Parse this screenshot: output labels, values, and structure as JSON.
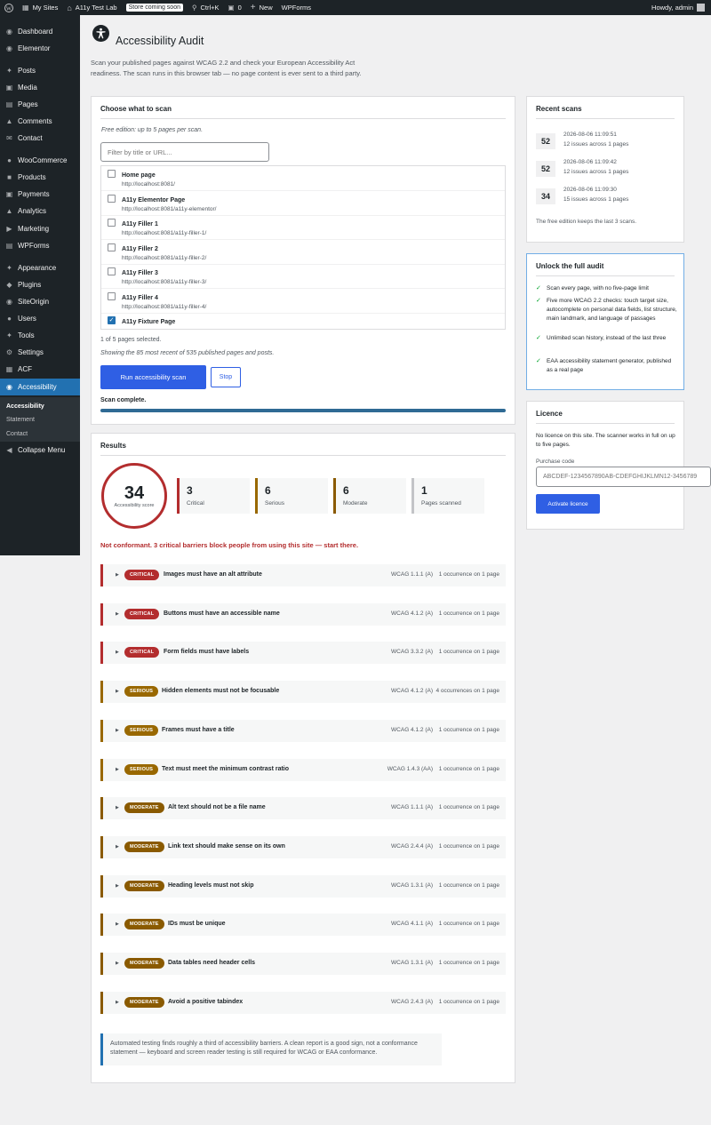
{
  "admin_bar": {
    "my_sites": "My Sites",
    "site_name": "A11y Test Lab",
    "store_badge": "Store coming soon",
    "search_shortcut": "Ctrl+K",
    "comments_count": "0",
    "new_label": "New",
    "wpforms": "WPForms",
    "howdy": "Howdy, admin"
  },
  "sidebar": {
    "items": [
      {
        "label": "Dashboard",
        "icon": "dashboard-icon"
      },
      {
        "label": "Elementor",
        "icon": "elementor-icon"
      },
      {
        "label": "Posts",
        "icon": "pin-icon"
      },
      {
        "label": "Media",
        "icon": "media-icon"
      },
      {
        "label": "Pages",
        "icon": "pages-icon"
      },
      {
        "label": "Comments",
        "icon": "comments-icon"
      },
      {
        "label": "Contact",
        "icon": "mail-icon"
      },
      {
        "label": "WooCommerce",
        "icon": "woo-icon"
      },
      {
        "label": "Products",
        "icon": "products-icon"
      },
      {
        "label": "Payments",
        "icon": "payments-icon"
      },
      {
        "label": "Analytics",
        "icon": "analytics-icon"
      },
      {
        "label": "Marketing",
        "icon": "megaphone-icon"
      },
      {
        "label": "WPForms",
        "icon": "forms-icon"
      },
      {
        "label": "Appearance",
        "icon": "brush-icon"
      },
      {
        "label": "Plugins",
        "icon": "plugin-icon"
      },
      {
        "label": "SiteOrigin",
        "icon": "siteorigin-icon"
      },
      {
        "label": "Users",
        "icon": "users-icon"
      },
      {
        "label": "Tools",
        "icon": "wrench-icon"
      },
      {
        "label": "Settings",
        "icon": "settings-icon"
      },
      {
        "label": "ACF",
        "icon": "acf-icon"
      },
      {
        "label": "Accessibility",
        "icon": "accessibility-icon"
      }
    ],
    "submenu": [
      "Accessibility",
      "Statement",
      "Contact"
    ],
    "collapse": "Collapse Menu"
  },
  "header": {
    "title": "Accessibility Audit",
    "intro": "Scan your published pages against WCAG 2.2 and check your European Accessibility Act readiness. The scan runs in this browser tab — no page content is ever sent to a third party."
  },
  "scan": {
    "title": "Choose what to scan",
    "edition_note": "Free edition: up to 5 pages per scan.",
    "filter_placeholder": "Filter by title or URL...",
    "pages": [
      {
        "name": "Home page",
        "url": "http://localhost:8081/",
        "checked": false
      },
      {
        "name": "A11y Elementor Page",
        "url": "http://localhost:8081/a11y-elementor/",
        "checked": false
      },
      {
        "name": "A11y Filler 1",
        "url": "http://localhost:8081/a11y-filler-1/",
        "checked": false
      },
      {
        "name": "A11y Filler 2",
        "url": "http://localhost:8081/a11y-filler-2/",
        "checked": false
      },
      {
        "name": "A11y Filler 3",
        "url": "http://localhost:8081/a11y-filler-3/",
        "checked": false
      },
      {
        "name": "A11y Filler 4",
        "url": "http://localhost:8081/a11y-filler-4/",
        "checked": false
      },
      {
        "name": "A11y Fixture Page",
        "url": "",
        "checked": true
      }
    ],
    "selected_count": "1 of 5 pages selected.",
    "showing_note": "Showing the 85 most recent of 535 published pages and posts.",
    "run_button": "Run accessibility scan",
    "stop_button": "Stop",
    "status": "Scan complete.",
    "progress": 1.0
  },
  "results": {
    "title": "Results",
    "score": "34",
    "score_label": "Accessibility score",
    "stats": [
      {
        "num": "3",
        "label": "Critical",
        "color": "#b32d2e"
      },
      {
        "num": "6",
        "label": "Serious",
        "color": "#996800"
      },
      {
        "num": "6",
        "label": "Moderate",
        "color": "#8a5a00"
      },
      {
        "num": "1",
        "label": "Pages scanned",
        "color": "#c3c4c7"
      }
    ],
    "verdict": "Not conformant. 3 critical barriers block people from using this site — start there.",
    "issues": [
      {
        "severity": "CRITICAL",
        "title": "Images must have an alt attribute",
        "wcag": "WCAG 1.1.1 (A)",
        "occ": "1 occurrence on 1 page"
      },
      {
        "severity": "CRITICAL",
        "title": "Buttons must have an accessible name",
        "wcag": "WCAG 4.1.2 (A)",
        "occ": "1 occurrence on 1 page"
      },
      {
        "severity": "CRITICAL",
        "title": "Form fields must have labels",
        "wcag": "WCAG 3.3.2 (A)",
        "occ": "1 occurrence on 1 page"
      },
      {
        "severity": "SERIOUS",
        "title": "Hidden elements must not be focusable",
        "wcag": "WCAG 4.1.2 (A)",
        "occ": "4 occurrences on 1 page"
      },
      {
        "severity": "SERIOUS",
        "title": "Frames must have a title",
        "wcag": "WCAG 4.1.2 (A)",
        "occ": "1 occurrence on 1 page"
      },
      {
        "severity": "SERIOUS",
        "title": "Text must meet the minimum contrast ratio",
        "wcag": "WCAG 1.4.3 (AA)",
        "occ": "1 occurrence on 1 page"
      },
      {
        "severity": "MODERATE",
        "title": "Alt text should not be a file name",
        "wcag": "WCAG 1.1.1 (A)",
        "occ": "1 occurrence on 1 page"
      },
      {
        "severity": "MODERATE",
        "title": "Link text should make sense on its own",
        "wcag": "WCAG 2.4.4 (A)",
        "occ": "1 occurrence on 1 page"
      },
      {
        "severity": "MODERATE",
        "title": "Heading levels must not skip",
        "wcag": "WCAG 1.3.1 (A)",
        "occ": "1 occurrence on 1 page"
      },
      {
        "severity": "MODERATE",
        "title": "IDs must be unique",
        "wcag": "WCAG 4.1.1 (A)",
        "occ": "1 occurrence on 1 page"
      },
      {
        "severity": "MODERATE",
        "title": "Data tables need header cells",
        "wcag": "WCAG 1.3.1 (A)",
        "occ": "1 occurrence on 1 page"
      },
      {
        "severity": "MODERATE",
        "title": "Avoid a positive tabindex",
        "wcag": "WCAG 2.4.3 (A)",
        "occ": "1 occurrence on 1 page"
      }
    ],
    "severity_colors": {
      "CRITICAL": "#b32d2e",
      "SERIOUS": "#996800",
      "MODERATE": "#8a5a00"
    },
    "note": "Automated testing finds roughly a third of accessibility barriers. A clean report is a good sign, not a conformance statement — keyboard and screen reader testing is still required for WCAG or EAA conformance."
  },
  "recent": {
    "title": "Recent scans",
    "scans": [
      {
        "score": "52",
        "date": "2026-08-06 11:09:51",
        "issues": "12 issues across 1 pages"
      },
      {
        "score": "52",
        "date": "2026-08-06 11:09:42",
        "issues": "12 issues across 1 pages"
      },
      {
        "score": "34",
        "date": "2026-08-06 11:09:30",
        "issues": "15 issues across 1 pages"
      }
    ],
    "note": "The free edition keeps the last 3 scans."
  },
  "unlock": {
    "title": "Unlock the full audit",
    "items": [
      "Scan every page, with no five-page limit",
      "Five more WCAG 2.2 checks: touch target size, autocomplete on personal data fields, list structure, main landmark, and language of passages",
      "Unlimited scan history, instead of the last three",
      "EAA accessibility statement generator, published as a real page"
    ]
  },
  "licence": {
    "title": "Licence",
    "status": "No licence on this site. The scanner works in full on up to five pages.",
    "purchase_label": "Purchase code",
    "purchase_placeholder": "ABCDEF-1234567890AB-CDEFGHIJKLMN12-3456789",
    "activate_button": "Activate licence"
  }
}
